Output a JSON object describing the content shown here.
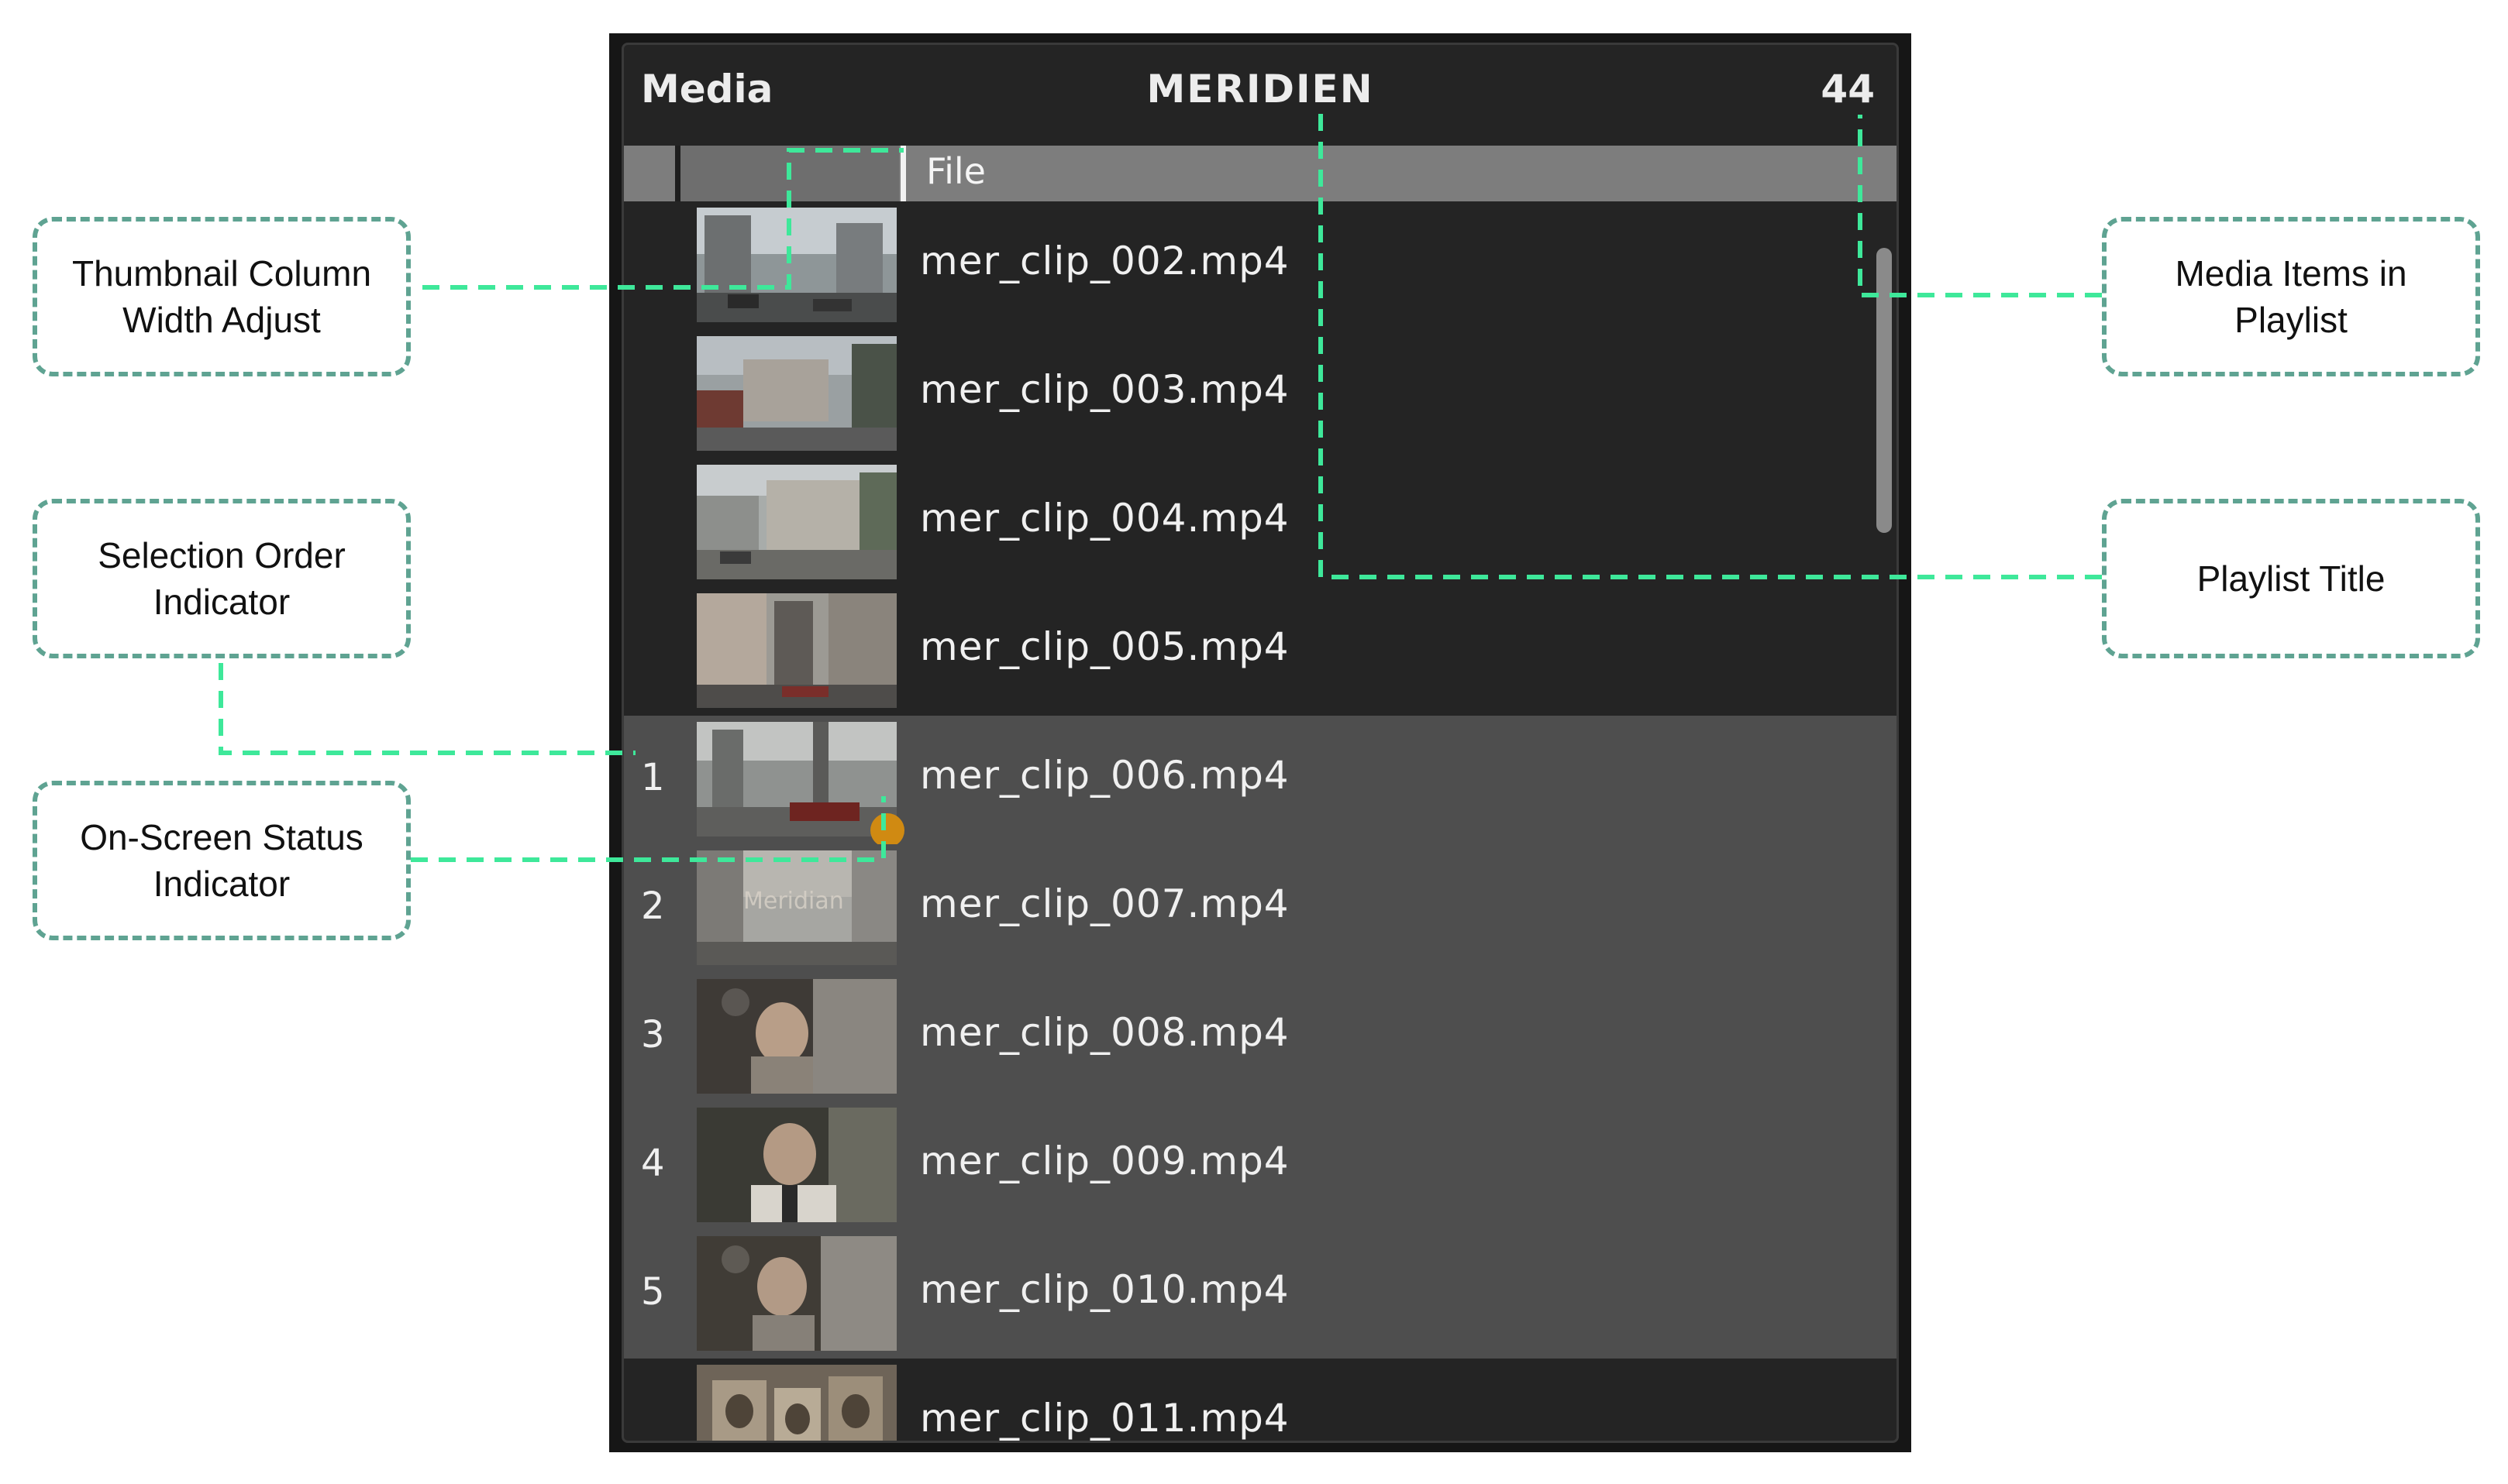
{
  "header": {
    "title": "Media",
    "playlist_title": "MERIDIEN",
    "item_count": "44"
  },
  "columns": {
    "file_label": "File"
  },
  "rows": [
    {
      "order": "",
      "file": "mer_clip_002.mp4",
      "selected": false
    },
    {
      "order": "",
      "file": "mer_clip_003.mp4",
      "selected": false
    },
    {
      "order": "",
      "file": "mer_clip_004.mp4",
      "selected": false
    },
    {
      "order": "",
      "file": "mer_clip_005.mp4",
      "selected": false
    },
    {
      "order": "1",
      "file": "mer_clip_006.mp4",
      "selected": true,
      "on_screen": true
    },
    {
      "order": "2",
      "file": "mer_clip_007.mp4",
      "selected": true,
      "thumb_text": "Meridian"
    },
    {
      "order": "3",
      "file": "mer_clip_008.mp4",
      "selected": true
    },
    {
      "order": "4",
      "file": "mer_clip_009.mp4",
      "selected": true
    },
    {
      "order": "5",
      "file": "mer_clip_010.mp4",
      "selected": true
    },
    {
      "order": "",
      "file": "mer_clip_011.mp4",
      "selected": false
    }
  ],
  "callouts": {
    "thumb_width": "Thumbnail Column Width Adjust",
    "selection_order": "Selection Order Indicator",
    "on_screen": "On-Screen Status Indicator",
    "media_items": "Media Items in Playlist",
    "playlist_title": "Playlist Title"
  },
  "colors": {
    "selected_row": "#4e4e4e",
    "panel_bg": "#242424",
    "status_dot": "#d08a12",
    "callout_border": "#5fa392",
    "leader_line": "#3ee89a"
  }
}
